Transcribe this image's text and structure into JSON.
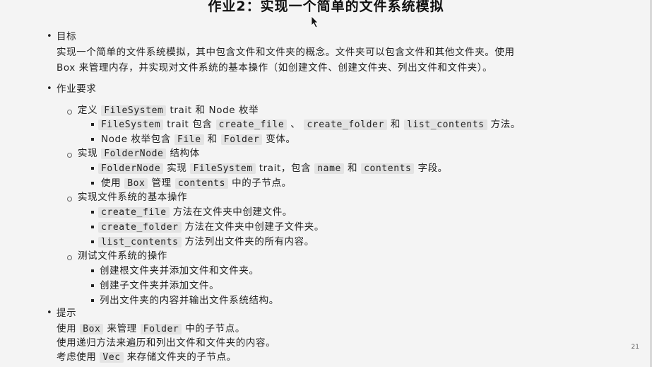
{
  "title": "作业2：实现一个简单的文件系统模拟",
  "goal": {
    "heading": "目标",
    "line1": "实现一个简单的文件系统模拟，其中包含文件和文件夹的概念。文件夹可以包含文件和其他文件夹。使用",
    "line2": "Box 来管理内存，并实现对文件系统的基本操作（如创建文件、创建文件夹、列出文件和文件夹）。"
  },
  "requirements": {
    "heading": "作业要求",
    "s1": {
      "pre": "定义",
      "c1": "FileSystem",
      "mid": "trait 和 Node 枚举"
    },
    "s1a": {
      "c1": "FileSystem",
      "t1": "trait 包含",
      "c2": "create_file",
      "t2": "、",
      "c3": "create_folder",
      "t3": "和",
      "c4": "list_contents",
      "t4": "方法。"
    },
    "s1b": {
      "t1": "Node 枚举包含",
      "c1": "File",
      "t2": "和",
      "c2": "Folder",
      "t3": "变体。"
    },
    "s2": {
      "pre": "实现",
      "c1": "FolderNode",
      "post": "结构体"
    },
    "s2a": {
      "c1": "FolderNode",
      "t1": "实现",
      "c2": "FileSystem",
      "t2": "trait，包含",
      "c3": "name",
      "t3": "和",
      "c4": "contents",
      "t4": "字段。"
    },
    "s2b": {
      "t1": "使用",
      "c1": "Box",
      "t2": "管理",
      "c2": "contents",
      "t3": "中的子节点。"
    },
    "s3": "实现文件系统的基本操作",
    "s3a": {
      "c1": "create_file",
      "t1": "方法在文件夹中创建文件。"
    },
    "s3b": {
      "c1": "create_folder",
      "t1": "方法在文件夹中创建子文件夹。"
    },
    "s3c": {
      "c1": "list_contents",
      "t1": "方法列出文件夹的所有内容。"
    },
    "s4": "测试文件系统的操作",
    "s4a": "创建根文件夹并添加文件和文件夹。",
    "s4b": "创建子文件夹并添加文件。",
    "s4c": "列出文件夹的内容并输出文件系统结构。"
  },
  "tips": {
    "heading": "提示",
    "l1": {
      "t1": "使用",
      "c1": "Box",
      "t2": "来管理",
      "c2": "Folder",
      "t3": "中的子节点。"
    },
    "l2": "使用递归方法来遍历和列出文件和文件夹的内容。",
    "l3": {
      "t1": "考虑使用",
      "c1": "Vec",
      "t2": "来存储文件夹的子节点。"
    }
  },
  "page_number": "21"
}
